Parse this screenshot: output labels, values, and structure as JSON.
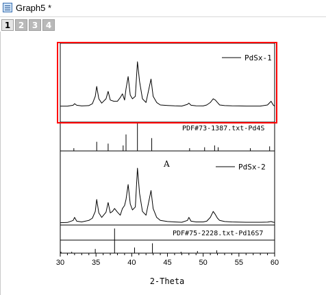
{
  "window": {
    "title": "Graph5 *"
  },
  "tabs": [
    "1",
    "2",
    "3",
    "4"
  ],
  "active_tab": "1",
  "colors": {
    "line": "#000000",
    "highlight": "#ff0000",
    "tab_inactive": "#b9b9b9"
  },
  "chart_data": [
    {
      "type": "line",
      "panel": "top",
      "series": [
        {
          "name": "PdSx-1",
          "x": [
            30,
            31,
            31.8,
            32,
            32.3,
            33,
            34,
            34.5,
            34.9,
            35.1,
            35.4,
            35.8,
            36.4,
            36.7,
            37,
            37.5,
            38,
            38.4,
            38.7,
            39,
            39.2,
            39.5,
            39.8,
            40.1,
            40.5,
            40.8,
            41.1,
            41.5,
            42,
            42.4,
            42.7,
            43,
            43.5,
            44,
            45,
            46,
            47,
            47.8,
            48,
            48.3,
            49,
            50,
            50.5,
            51,
            51.4,
            51.7,
            52,
            52.3,
            53,
            54,
            55,
            56,
            57,
            58,
            59,
            59.5,
            59.8,
            60
          ],
          "y": [
            4,
            4,
            4.8,
            6,
            4.8,
            4.2,
            4.5,
            6,
            12,
            20,
            10,
            6.5,
            10,
            16,
            9,
            8,
            8,
            11,
            14,
            9,
            18,
            28,
            13,
            10,
            12,
            40,
            24,
            10,
            7,
            18,
            26,
            12,
            7,
            5,
            4.6,
            4.3,
            4.1,
            5.5,
            6.5,
            4.8,
            4.3,
            4.2,
            5,
            7,
            10,
            9,
            7,
            5,
            4.5,
            4.3,
            4.2,
            4.1,
            4.1,
            4.1,
            5,
            8,
            5,
            4
          ]
        }
      ],
      "ylim": [
        0,
        50
      ],
      "annotation": "PdSx-1"
    },
    {
      "type": "bar",
      "panel": "reference-1",
      "label": "PDF#73-1387.txt-Pd4S",
      "x": [
        31.9,
        35.1,
        36.7,
        38.8,
        39.2,
        40.8,
        42.8,
        48.1,
        50.2,
        51.6,
        52.1,
        56.6,
        59.3
      ],
      "values": [
        3,
        10,
        8,
        6,
        18,
        30,
        14,
        3,
        4,
        6,
        4,
        3,
        5
      ],
      "ylim": [
        0,
        30
      ]
    },
    {
      "type": "line",
      "panel": "middle",
      "series": [
        {
          "name": "PdSx-2",
          "x": [
            30,
            31,
            31.8,
            32,
            32.3,
            33,
            34,
            34.5,
            34.9,
            35.1,
            35.4,
            35.8,
            36.4,
            36.7,
            37,
            37.3,
            37.6,
            38,
            38.4,
            38.7,
            39,
            39.2,
            39.5,
            39.8,
            40.1,
            40.5,
            40.8,
            41.1,
            41.5,
            42,
            42.4,
            42.7,
            43,
            43.5,
            44,
            45,
            46,
            47,
            47.8,
            48,
            48.3,
            49,
            50,
            50.5,
            51,
            51.4,
            51.7,
            52,
            52.3,
            53,
            54,
            55,
            56,
            57,
            58,
            59,
            59.5,
            59.8,
            60
          ],
          "y": [
            5,
            5.2,
            8,
            12,
            7,
            6,
            8,
            11,
            20,
            36,
            18,
            12,
            19,
            32,
            18,
            20,
            24,
            19,
            15,
            24,
            28,
            36,
            56,
            30,
            22,
            26,
            78,
            44,
            20,
            15,
            34,
            48,
            24,
            12,
            8,
            6.5,
            6,
            5.5,
            8,
            12,
            7,
            6,
            6,
            7,
            12,
            20,
            16,
            11,
            8,
            6.5,
            6,
            5.8,
            5.5,
            5.5,
            5.5,
            5.8,
            6.5,
            5.6,
            5.2
          ]
        }
      ],
      "ylim": [
        0,
        90
      ],
      "annotation": "A",
      "legend": "PdSx-2"
    },
    {
      "type": "bar",
      "panel": "reference-2",
      "label": "PDF#75-2228.txt-Pd16S7",
      "x": [
        30.1,
        31.6,
        34.9,
        37.6,
        40.4,
        42.9,
        46.9,
        49.2,
        51.9
      ],
      "values": [
        2,
        2,
        6,
        35,
        8,
        14,
        2,
        3,
        4
      ],
      "ylim": [
        0,
        36
      ]
    }
  ],
  "axes": {
    "xlabel": "2-Theta",
    "xlim": [
      30,
      60
    ],
    "xticks": [
      30,
      35,
      40,
      45,
      50,
      55,
      60
    ],
    "tick_labels": [
      "30",
      "35",
      "40",
      "45",
      "50",
      "55",
      "60"
    ]
  }
}
